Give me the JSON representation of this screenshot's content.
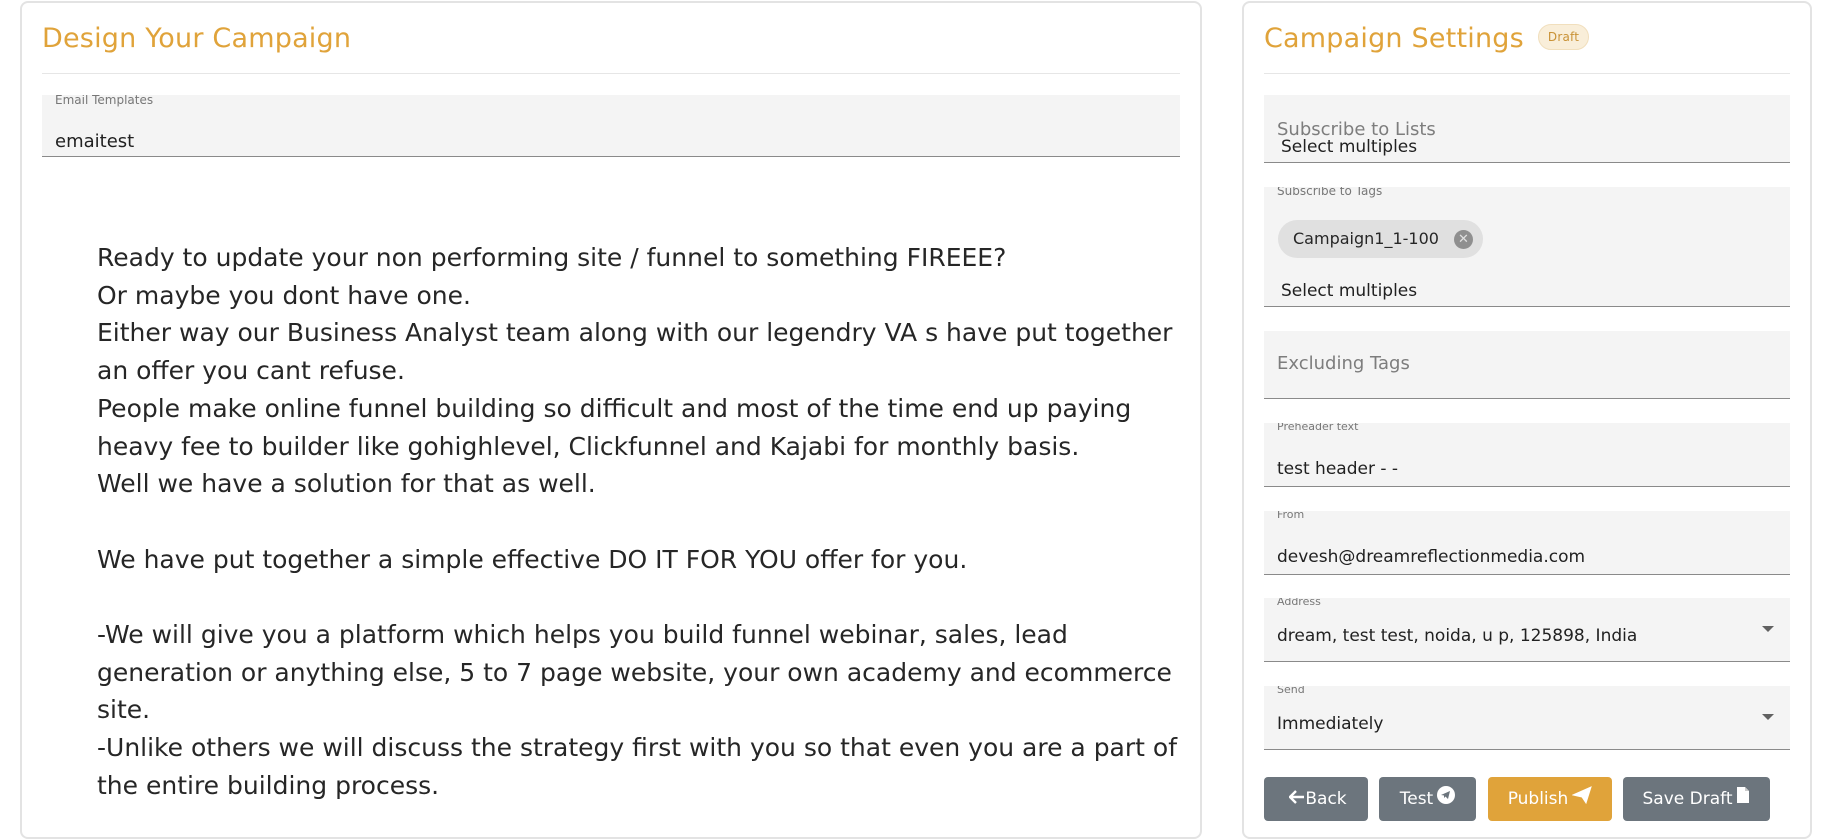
{
  "design": {
    "title": "Design Your Campaign",
    "template_label": "Email Templates",
    "template_value": "emaitest",
    "body_lines": [
      "Ready to update your non performing site / funnel to something FIREEE?",
      "Or maybe you dont have one.",
      "Either way our Business Analyst team along with our legendry VA s have put together an offer you cant refuse.",
      "People make online funnel building so difficult and most of the time end up paying heavy fee to builder like gohighlevel, Clickfunnel and Kajabi for monthly basis.",
      "Well we have a solution for that as well.",
      "",
      "We have put together a simple effective DO IT FOR YOU offer for you.",
      "",
      "-We will give you a platform which helps you build funnel webinar, sales, lead generation or anything else, 5 to 7 page website, your own academy and ecommerce site.",
      "-Unlike others we will discuss the strategy first with you so that even you are a part of the entire building process."
    ]
  },
  "settings": {
    "title": "Campaign Settings",
    "badge": "Draft",
    "lists": {
      "label": "Subscribe to Lists",
      "placeholder": "Select multiples"
    },
    "tags": {
      "label": "Subscribe to Tags",
      "chips": [
        "Campaign1_1-100"
      ],
      "placeholder": "Select multiples"
    },
    "excluding_tags": {
      "label": "Excluding Tags"
    },
    "preheader": {
      "label": "Preheader text",
      "value": "test header -  -"
    },
    "from": {
      "label": "From",
      "value": "devesh@dreamreflectionmedia.com"
    },
    "address": {
      "label": "Address",
      "value": "dream, test test, noida, u p, 125898, India"
    },
    "send": {
      "label": "Send",
      "value": "Immediately"
    }
  },
  "buttons": {
    "back": "Back",
    "test": "Test",
    "publish": "Publish",
    "save_draft": "Save Draft"
  },
  "icons": {
    "back": "arrow-left-icon",
    "test": "telegram-icon",
    "publish": "paper-plane-icon",
    "save": "file-icon"
  },
  "colors": {
    "accent": "#e0a33a",
    "secondary_button": "#6c757d",
    "badge_bg": "#f9eed9"
  }
}
